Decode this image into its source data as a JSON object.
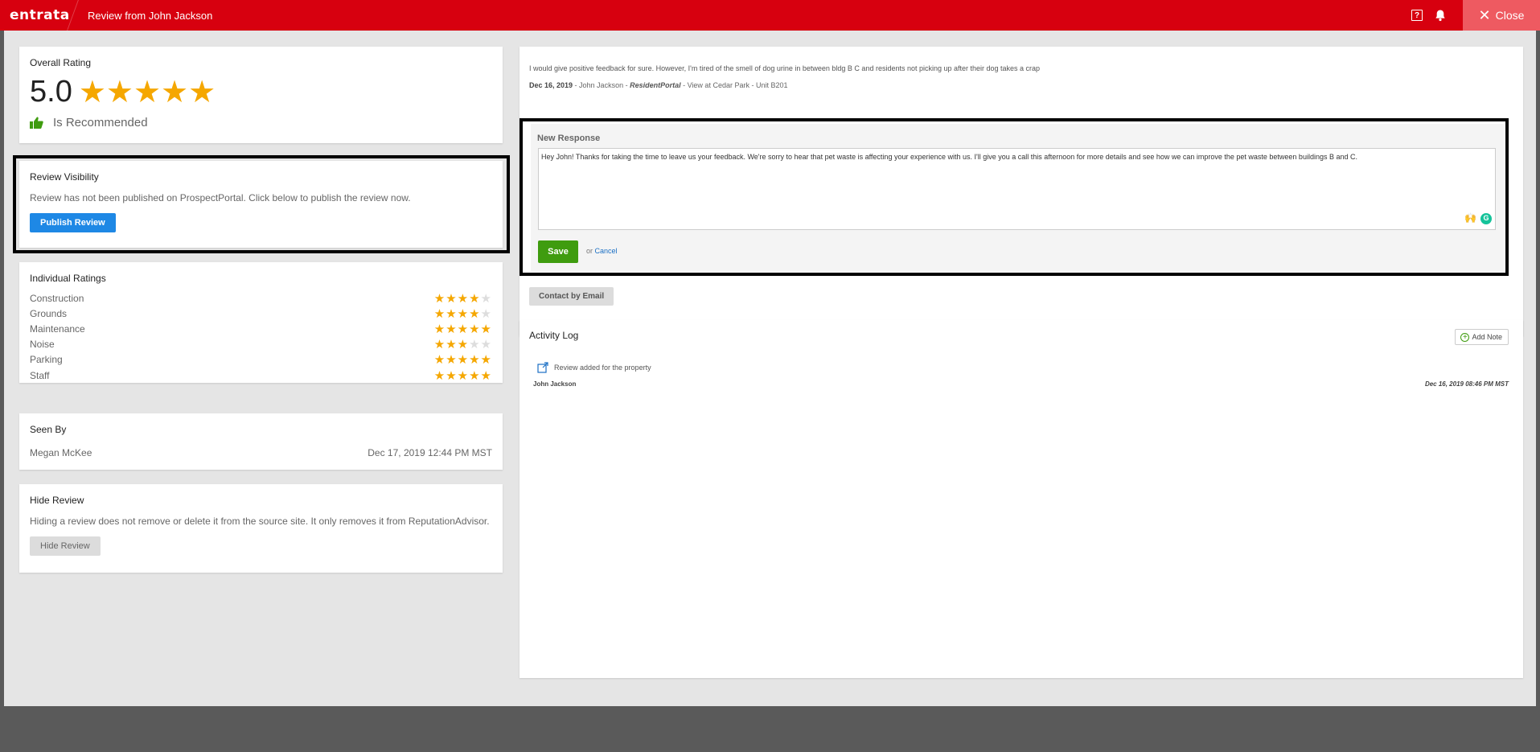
{
  "header": {
    "logo": "entrata",
    "title": "Review from John Jackson",
    "help_label": "?",
    "close_label": "Close"
  },
  "overall": {
    "title": "Overall Rating",
    "score": "5.0",
    "stars": "★★★★★",
    "recommended_label": "Is Recommended"
  },
  "visibility": {
    "title": "Review Visibility",
    "description": "Review has not been published on ProspectPortal. Click below to publish the review now.",
    "button_label": "Publish Review"
  },
  "individual": {
    "title": "Individual Ratings",
    "items": [
      {
        "label": "Construction",
        "on": "★★★★",
        "off": "★",
        "rating": 4
      },
      {
        "label": "Grounds",
        "on": "★★★★",
        "off": "★",
        "rating": 4
      },
      {
        "label": "Maintenance",
        "on": "★★★★★",
        "off": "",
        "rating": 5
      },
      {
        "label": "Noise",
        "on": "★★★",
        "off": "★★",
        "rating": 3
      },
      {
        "label": "Parking",
        "on": "★★★★★",
        "off": "",
        "rating": 5
      },
      {
        "label": "Staff",
        "on": "★★★★★",
        "off": "",
        "rating": 5
      }
    ]
  },
  "seen_by": {
    "title": "Seen By",
    "name": "Megan McKee",
    "date": "Dec 17, 2019 12:44 PM MST"
  },
  "hide": {
    "title": "Hide Review",
    "description": "Hiding a review does not remove or delete it from the source site. It only removes it from ReputationAdvisor.",
    "button_label": "Hide Review"
  },
  "review": {
    "text": "I would give positive feedback for sure. However, I'm tired of the smell of dog urine in between bldg B C and residents not picking up after their dog takes a crap",
    "date": "Dec 16, 2019",
    "author_part": " - John Jackson  -  ",
    "source": "ResidentPortal",
    "location_part": " - View at Cedar Park - Unit B201"
  },
  "response": {
    "label": "New Response",
    "value": "Hey John! Thanks for taking the time to leave us your feedback. We're sorry to hear that pet waste is affecting your experience with us. I'll give you a call this afternoon for more details and see how we can improve the pet waste between buildings B and C.",
    "hands_glyph": "🙌",
    "grammarly_glyph": "G",
    "save_label": "Save",
    "or_label": "or",
    "cancel_label": "Cancel"
  },
  "contact_label": "Contact by Email",
  "activity": {
    "title": "Activity Log",
    "add_note_label": "Add Note",
    "plus_glyph": "+",
    "entry_text": "Review added for the property",
    "entry_author": "John Jackson",
    "entry_date": "Dec 16, 2019 08:46 PM MST"
  },
  "colors": {
    "brand_red": "#d7000f",
    "close_bg": "#ee5a61",
    "star": "#f5a700",
    "publish_blue": "#1e88e5",
    "save_green": "#3f9c0f"
  }
}
